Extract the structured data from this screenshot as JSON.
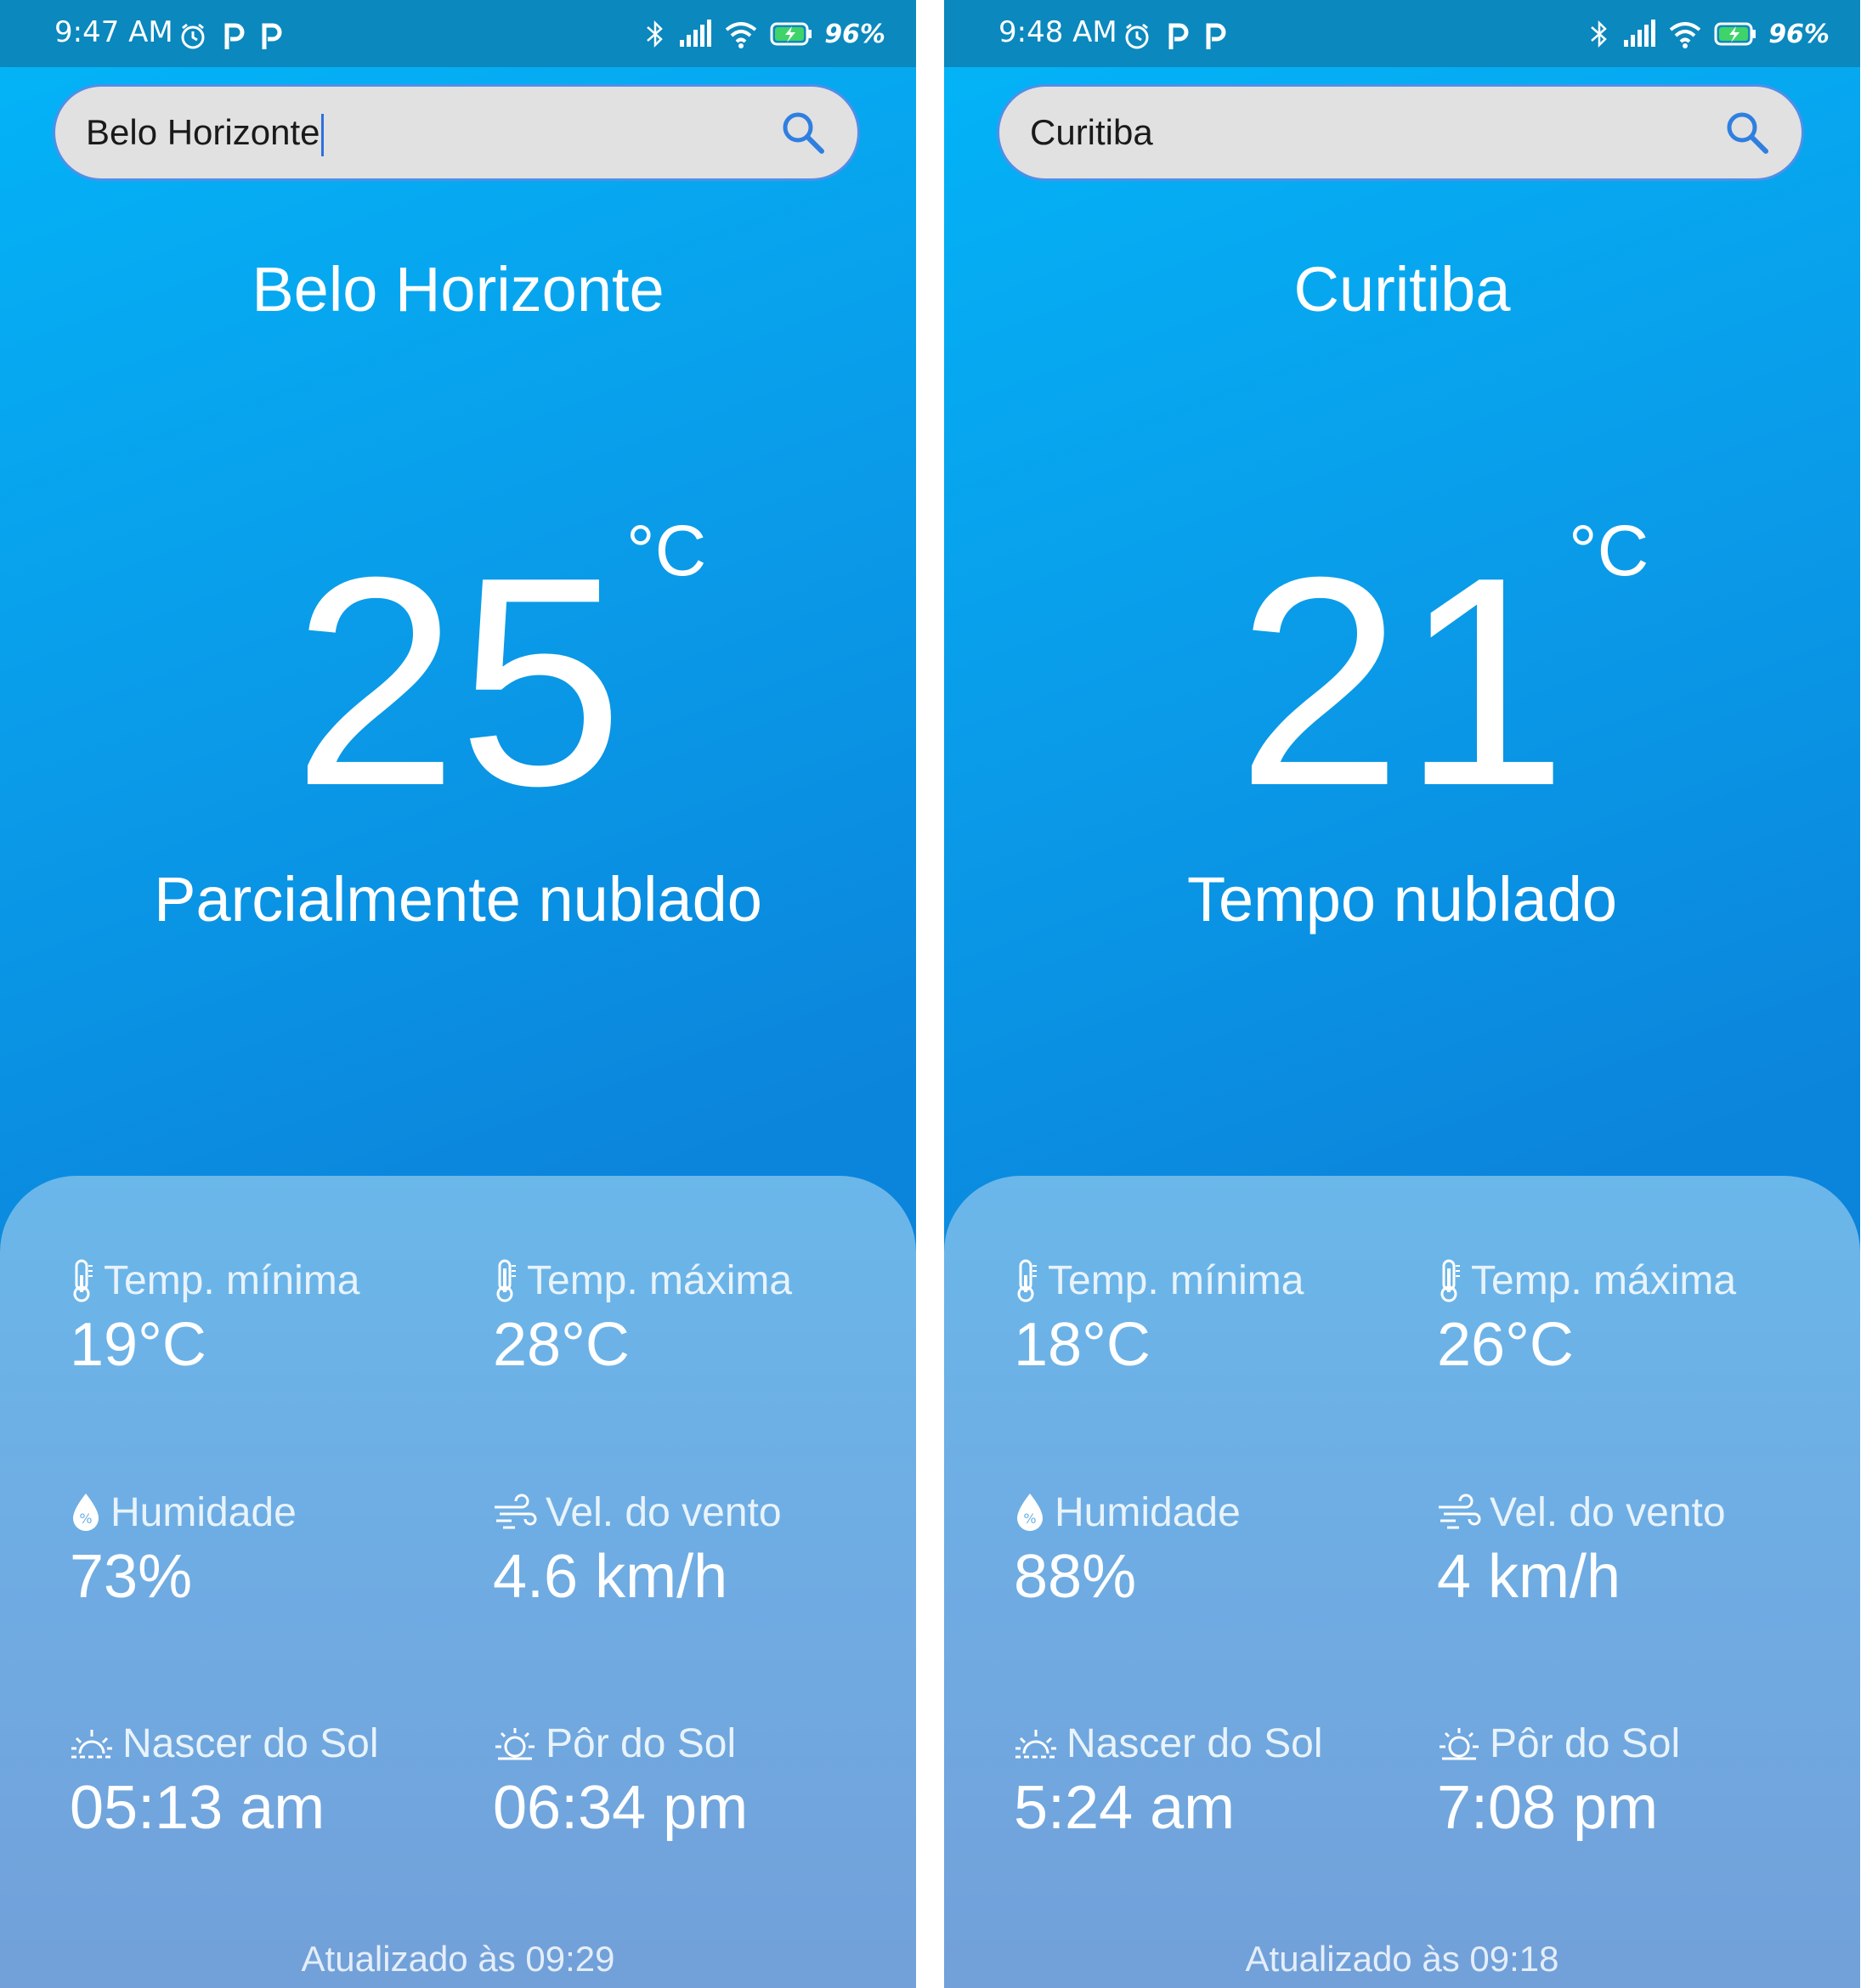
{
  "screens": [
    {
      "status": {
        "time": "9:47 AM",
        "battery": "96%"
      },
      "search": {
        "value": "Belo Horizonte",
        "icon": "search-icon"
      },
      "city": "Belo Horizonte",
      "temperature": "25",
      "unit": "°C",
      "condition": "Parcialmente nublado",
      "metrics": {
        "min_label": "Temp. mínima",
        "min_value": "19°C",
        "max_label": "Temp. máxima",
        "max_value": "28°C",
        "humidity_label": "Humidade",
        "humidity_value": "73%",
        "wind_label": "Vel. do vento",
        "wind_value": "4.6 km/h",
        "sunrise_label": "Nascer do Sol",
        "sunrise_value": "05:13 am",
        "sunset_label": "Pôr do Sol",
        "sunset_value": "06:34 pm"
      },
      "updated": "Atualizado às 09:29"
    },
    {
      "status": {
        "time": "9:48 AM",
        "battery": "96%"
      },
      "search": {
        "value": "Curitiba",
        "icon": "search-icon"
      },
      "city": "Curitiba",
      "temperature": "21",
      "unit": "°C",
      "condition": "Tempo nublado",
      "metrics": {
        "min_label": "Temp. mínima",
        "min_value": "18°C",
        "max_label": "Temp. máxima",
        "max_value": "26°C",
        "humidity_label": "Humidade",
        "humidity_value": "88%",
        "wind_label": "Vel. do vento",
        "wind_value": "4 km/h",
        "sunrise_label": "Nascer do Sol",
        "sunrise_value": "5:24 am",
        "sunset_label": "Pôr do Sol",
        "sunset_value": "7:08 pm"
      },
      "updated": "Atualizado às 09:18"
    }
  ],
  "colors": {
    "statusbar": "#0b88bd",
    "gradient_top": "#03b5f8",
    "gradient_bottom": "#0c80d8",
    "panel": "#6fabe2",
    "search_bg": "#e1e1e1",
    "search_icon": "#2f7fe0"
  }
}
